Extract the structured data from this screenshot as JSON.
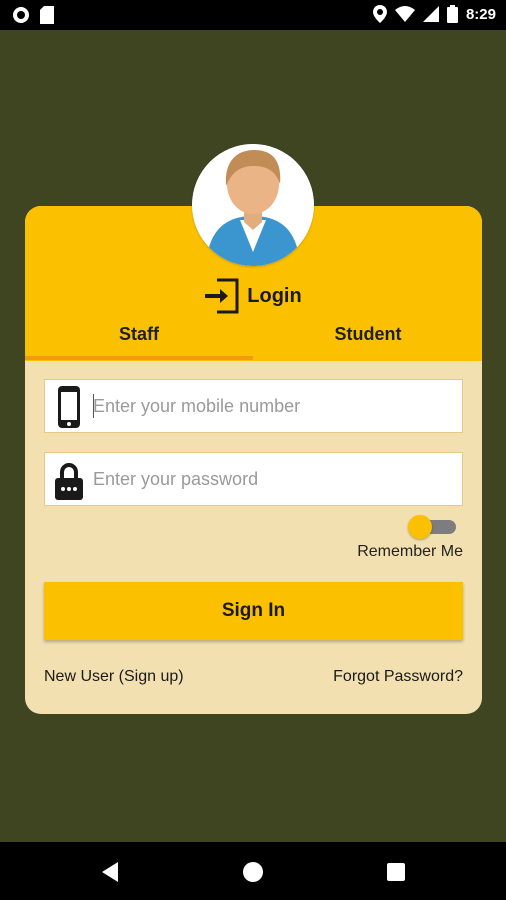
{
  "status_bar": {
    "time": "8:29",
    "left_icons": [
      "circle-icon",
      "sd-card-icon"
    ],
    "right_icons": [
      "location-icon",
      "wifi-icon",
      "signal-icon",
      "battery-icon"
    ]
  },
  "header": {
    "title": "Login",
    "icon": "login-icon",
    "avatar_icon": "user-avatar-icon"
  },
  "tabs": [
    {
      "label": "Staff",
      "selected": true
    },
    {
      "label": "Student",
      "selected": false
    }
  ],
  "form": {
    "mobile": {
      "placeholder": "Enter your mobile number",
      "value": "",
      "icon": "mobile-phone-icon"
    },
    "password": {
      "placeholder": "Enter your password",
      "value": "",
      "icon": "lock-icon"
    },
    "remember": {
      "label": "Remember Me",
      "on": true
    },
    "submit_label": "Sign In"
  },
  "links": {
    "signup": "New User (Sign up)",
    "forgot": "Forgot Password?"
  },
  "colors": {
    "background": "#3f4520",
    "accent": "#fbc100",
    "card": "#f2e0b0",
    "tab_indicator": "#f39a12"
  },
  "nav_bar": [
    "back-icon",
    "home-icon",
    "recents-icon"
  ]
}
